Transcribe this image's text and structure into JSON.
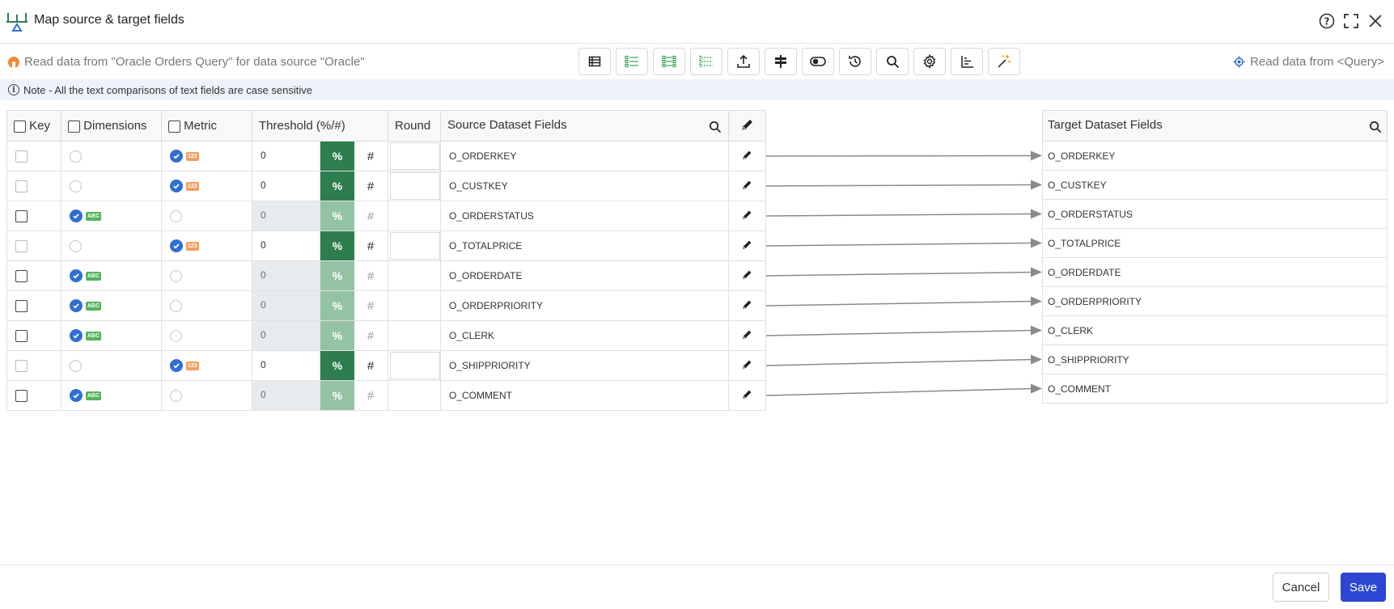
{
  "window": {
    "title": "Map source & target fields",
    "help_icon": "help-icon",
    "expand_icon": "expand-icon",
    "close_icon": "close-icon"
  },
  "toolbar": {
    "source_info": "Read data from \"Oracle Orders Query\" for data source \"Oracle\"",
    "target_info": "Read data from <Query>",
    "tools": [
      {
        "name": "table-view-icon"
      },
      {
        "name": "list-check-icon"
      },
      {
        "name": "list-check-alt-icon"
      },
      {
        "name": "list-dashed-icon"
      },
      {
        "name": "upload-icon"
      },
      {
        "name": "signpost-icon"
      },
      {
        "name": "toggle-icon"
      },
      {
        "name": "history-icon"
      },
      {
        "name": "search-icon"
      },
      {
        "name": "gear-icon"
      },
      {
        "name": "axis-chart-icon"
      },
      {
        "name": "magic-wand-icon"
      }
    ]
  },
  "note": "Note - All the text comparisons of text fields are case sensitive",
  "source_table": {
    "headers": {
      "key": "Key",
      "dimensions": "Dimensions",
      "metric": "Metric",
      "threshold": "Threshold (%/#)",
      "round": "Round",
      "source_fields": "Source Dataset Fields"
    },
    "rows": [
      {
        "type": "metric",
        "threshold": "0",
        "pct": "%",
        "hash": "#",
        "field": "O_ORDERKEY"
      },
      {
        "type": "metric",
        "threshold": "0",
        "pct": "%",
        "hash": "#",
        "field": "O_CUSTKEY"
      },
      {
        "type": "dimension",
        "threshold": "0",
        "pct": "%",
        "hash": "#",
        "field": "O_ORDERSTATUS"
      },
      {
        "type": "metric",
        "threshold": "0",
        "pct": "%",
        "hash": "#",
        "field": "O_TOTALPRICE"
      },
      {
        "type": "dimension",
        "threshold": "0",
        "pct": "%",
        "hash": "#",
        "field": "O_ORDERDATE"
      },
      {
        "type": "dimension",
        "threshold": "0",
        "pct": "%",
        "hash": "#",
        "field": "O_ORDERPRIORITY"
      },
      {
        "type": "dimension",
        "threshold": "0",
        "pct": "%",
        "hash": "#",
        "field": "O_CLERK"
      },
      {
        "type": "metric",
        "threshold": "0",
        "pct": "%",
        "hash": "#",
        "field": "O_SHIPPRIORITY"
      },
      {
        "type": "dimension",
        "threshold": "0",
        "pct": "%",
        "hash": "#",
        "field": "O_COMMENT"
      }
    ],
    "badges": {
      "abc": "ABC",
      "num": "123"
    }
  },
  "target_table": {
    "header": "Target Dataset Fields",
    "rows": [
      "O_ORDERKEY",
      "O_CUSTKEY",
      "O_ORDERSTATUS",
      "O_TOTALPRICE",
      "O_ORDERDATE",
      "O_ORDERPRIORITY",
      "O_CLERK",
      "O_SHIPPRIORITY",
      "O_COMMENT"
    ]
  },
  "footer": {
    "cancel_label": "Cancel",
    "save_label": "Save"
  },
  "colors": {
    "accent": "#2c46d3",
    "check_blue": "#2f6fd4",
    "pct_green": "#2e7d4f",
    "pct_green_disabled": "#94c3a4",
    "source_dot": "#f08a38"
  }
}
